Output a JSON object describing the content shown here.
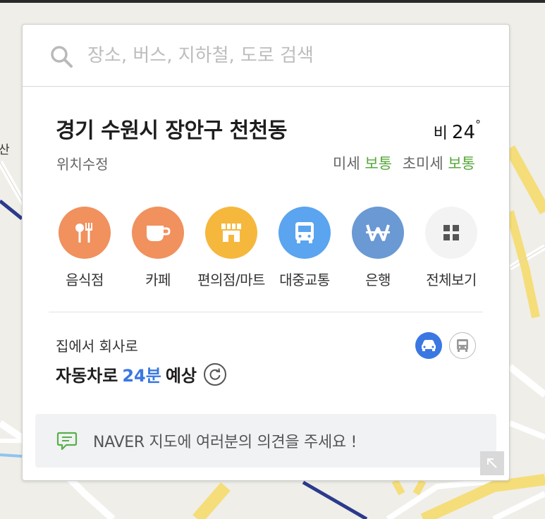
{
  "search": {
    "placeholder": "장소, 버스, 지하철, 도로 검색"
  },
  "map": {
    "partial_label": "산"
  },
  "location": {
    "title": "경기 수원시 장안구 천천동",
    "edit_label": "위치수정"
  },
  "weather": {
    "condition": "비",
    "temperature": "24",
    "degree_symbol": "°"
  },
  "dust": {
    "fine_label": "미세",
    "fine_status": "보통",
    "ultrafine_label": "초미세",
    "ultrafine_status": "보통"
  },
  "categories": [
    {
      "label": "음식점",
      "color": "#f0915e",
      "icon": "utensils-icon"
    },
    {
      "label": "카페",
      "color": "#f0915e",
      "icon": "coffee-cup-icon"
    },
    {
      "label": "편의점/마트",
      "color": "#f5b83d",
      "icon": "store-icon"
    },
    {
      "label": "대중교통",
      "color": "#5aa4f0",
      "icon": "bus-icon"
    },
    {
      "label": "은행",
      "color": "#6a99d4",
      "icon": "won-icon"
    },
    {
      "label": "전체보기",
      "color": "#f3f3f3",
      "icon": "grid-icon"
    }
  ],
  "commute": {
    "label": "집에서 회사로",
    "prefix": "자동차로",
    "minutes": "24분",
    "suffix": "예상"
  },
  "feedback": {
    "text": "NAVER 지도에 여러분의 의견을 주세요 !"
  },
  "colors": {
    "accent_blue": "#3a77e2",
    "good_green": "#57a83b",
    "road_yellow": "#f5dd79",
    "subway_blue": "#2b3a8c"
  }
}
